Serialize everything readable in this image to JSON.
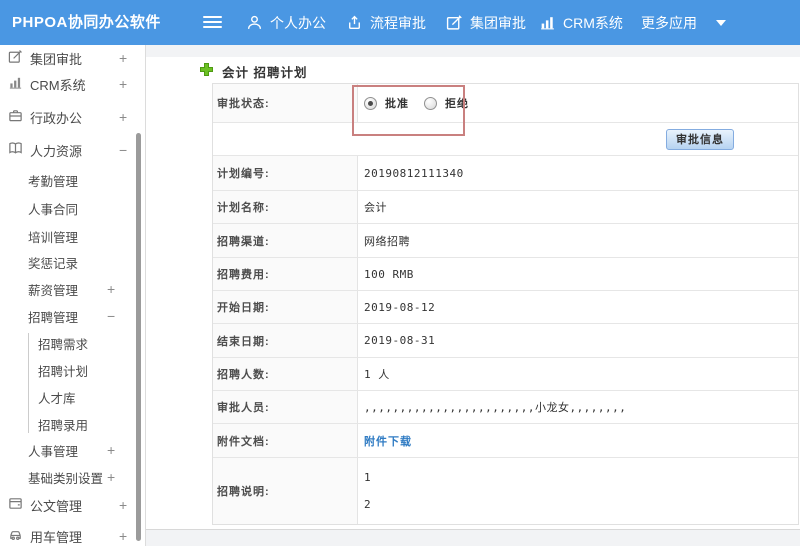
{
  "header": {
    "logo": "PHPOA协同办公软件",
    "nav": [
      {
        "label": "个人办公",
        "icon": "user-icon"
      },
      {
        "label": "流程审批",
        "icon": "share-icon"
      },
      {
        "label": "集团审批",
        "icon": "edit-icon"
      },
      {
        "label": "CRM系统",
        "icon": "bar-chart-icon"
      },
      {
        "label": "更多应用",
        "icon": "caret-down-icon"
      }
    ]
  },
  "sidebar": {
    "items": [
      {
        "label": "集团审批",
        "icon": "edit-icon",
        "toggle": "+",
        "level": 1
      },
      {
        "label": "CRM系统",
        "icon": "bar-chart-icon",
        "toggle": "+",
        "level": 1
      },
      {
        "label": "行政办公",
        "icon": "briefcase-icon",
        "toggle": "+",
        "level": 1
      },
      {
        "label": "人力资源",
        "icon": "book-icon",
        "toggle": "−",
        "level": 1
      },
      {
        "label": "考勤管理",
        "level": 2
      },
      {
        "label": "人事合同",
        "level": 2
      },
      {
        "label": "培训管理",
        "level": 2
      },
      {
        "label": "奖惩记录",
        "level": 2
      },
      {
        "label": "薪资管理",
        "toggle": "+",
        "level": 2
      },
      {
        "label": "招聘管理",
        "toggle": "−",
        "level": 2
      },
      {
        "label": "招聘需求",
        "level": 3
      },
      {
        "label": "招聘计划",
        "level": 3
      },
      {
        "label": "人才库",
        "level": 3
      },
      {
        "label": "招聘录用",
        "level": 3
      },
      {
        "label": "人事管理",
        "toggle": "+",
        "level": 2
      },
      {
        "label": "基础类别设置",
        "toggle": "+",
        "level": 2
      },
      {
        "label": "公文管理",
        "icon": "document-icon",
        "toggle": "+",
        "level": 1
      },
      {
        "label": "用车管理",
        "icon": "car-icon",
        "toggle": "+",
        "level": 1
      }
    ]
  },
  "main": {
    "page_title": "会计 招聘计划",
    "approval": {
      "label": "审批状态:",
      "options": [
        {
          "label": "批准",
          "selected": true
        },
        {
          "label": "拒绝",
          "selected": false
        }
      ]
    },
    "approve_button": "审批信息",
    "fields": [
      {
        "label": "计划编号:",
        "value": "20190812111340"
      },
      {
        "label": "计划名称:",
        "value": "会计"
      },
      {
        "label": "招聘渠道:",
        "value": "网络招聘"
      },
      {
        "label": "招聘费用:",
        "value": "100 RMB"
      },
      {
        "label": "开始日期:",
        "value": "2019-08-12"
      },
      {
        "label": "结束日期:",
        "value": "2019-08-31"
      },
      {
        "label": "招聘人数:",
        "value": "1 人"
      },
      {
        "label": "审批人员:",
        "value": ",,,,,,,,,,,,,,,,,,,,,,,,小龙女,,,,,,,,"
      }
    ],
    "attachment": {
      "label": "附件文档:",
      "link": "附件下载"
    },
    "description": {
      "label": "招聘说明:",
      "line1": "1",
      "line2": "2"
    }
  },
  "colors": {
    "header_blue": "#4a97e3",
    "link_blue": "#2f7bc3",
    "annotation_red": "#c9807f",
    "plus_green": "#6cc024"
  }
}
